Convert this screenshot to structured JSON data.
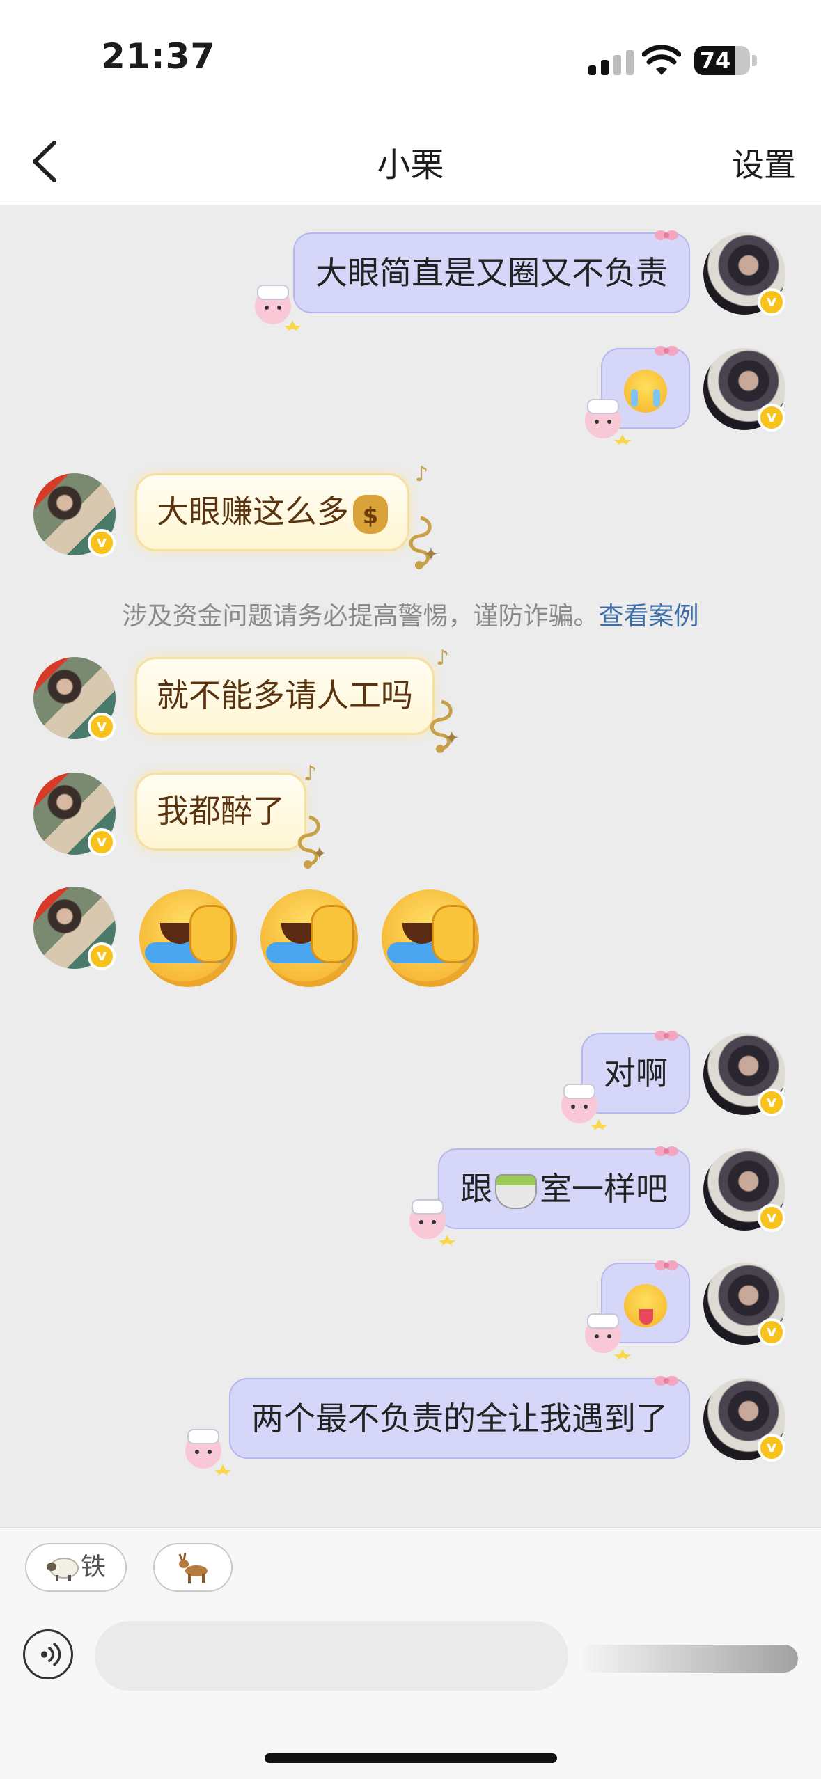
{
  "status_bar": {
    "time": "21:37",
    "battery": "74",
    "battery_level": 0.74
  },
  "nav": {
    "back_icon": "chevron-left-icon",
    "title": "小栗",
    "settings_label": "设置"
  },
  "messages": {
    "m1": {
      "text": "大眼简直是又圈又不负责"
    },
    "m2": {
      "emoji": "crying-face"
    },
    "m3": {
      "text": "大眼赚这么多",
      "emoji": "money-bag"
    },
    "m4": {
      "text": "就不能多请人工吗"
    },
    "m5": {
      "text": "我都醉了"
    },
    "m6": {
      "emoji": "rolling-on-floor-laughing"
    },
    "m7": {
      "text": "对啊"
    },
    "m8": {
      "text_before": "跟",
      "emoji": "tea-cup",
      "text_after": "室一样吧"
    },
    "m9": {
      "emoji": "face-with-tongue"
    },
    "m10": {
      "text": "两个最不负责的全让我遇到了"
    }
  },
  "notice": {
    "text": "涉及资金问题请务必提高警惕，谨防诈骗。",
    "link": "查看案例"
  },
  "quick_replies": [
    {
      "icon": "sheep-icon",
      "label": "铁"
    },
    {
      "icon": "deer-icon",
      "label": ""
    }
  ],
  "composer": {
    "voice_icon": "voice-icon",
    "placeholder": ""
  },
  "colors": {
    "my_bubble": "#d5d6f8",
    "their_bubble": "#fff6d4",
    "link": "#3f6ea8",
    "badge": "#f7c21b"
  }
}
